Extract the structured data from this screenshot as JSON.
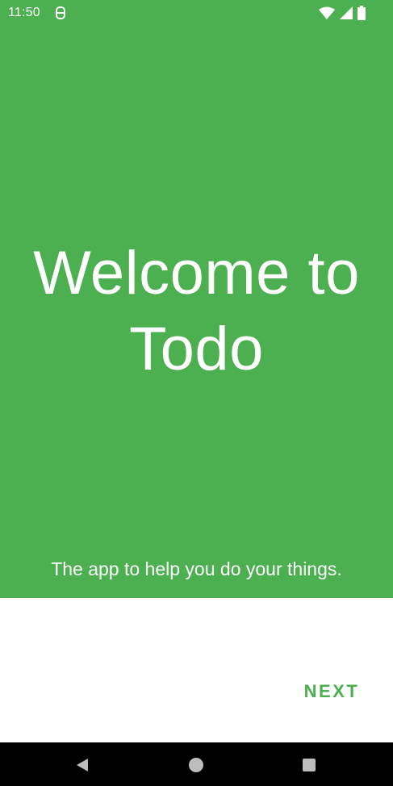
{
  "status_bar": {
    "time": "11:50",
    "icons": [
      "app-notification-icon",
      "wifi-icon",
      "signal-icon",
      "battery-icon"
    ]
  },
  "hero": {
    "background_color": "#4caf50",
    "title": "Welcome to Todo",
    "subtitle": "The app to help you do your things."
  },
  "actions": {
    "next_label": "NEXT",
    "accent_color": "#4caf50"
  },
  "nav_bar": {
    "icons": [
      "back-icon",
      "home-icon",
      "recents-icon"
    ]
  }
}
